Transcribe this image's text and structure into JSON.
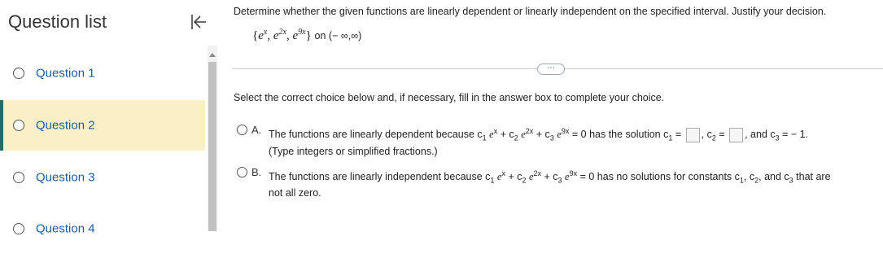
{
  "sidebar": {
    "title": "Question list",
    "questions": [
      {
        "label": "Question 1"
      },
      {
        "label": "Question 2"
      },
      {
        "label": "Question 3"
      },
      {
        "label": "Question 4"
      }
    ],
    "active_index": 1
  },
  "question": {
    "instruction": "Determine whether the given functions are linearly dependent or linearly independent on the specified interval. Justify your decision.",
    "functions": {
      "f1_exp": "x",
      "f2_coef": "2x",
      "f3_coef": "9x",
      "base": "e"
    },
    "interval": "on (− ∞,∞)",
    "more_label": "⋯",
    "select_prompt": "Select the correct choice below and, if necessary, fill in the answer box to complete your choice.",
    "choices": [
      {
        "letter": "A.",
        "text_pre": "The functions are linearly dependent because c",
        "text_post": "= 0 has the solution c",
        "c2_label": ", c",
        "c3_text": ", and c",
        "c3_value": " = − 1.",
        "note": "(Type integers or simplified fractions.)"
      },
      {
        "letter": "B.",
        "text_pre": "The functions are linearly independent because c",
        "text_post": "= 0 has no solutions for constants c",
        "tail": ", and c",
        "tail_end": " that are",
        "line2": "not all zero."
      }
    ]
  }
}
